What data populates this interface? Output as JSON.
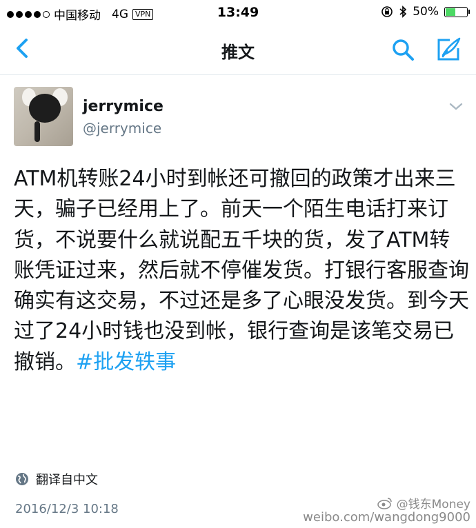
{
  "status_bar": {
    "carrier": "中国移动",
    "network": "4G",
    "vpn": "VPN",
    "time": "13:49",
    "battery": "50%",
    "battery_level": 0.5
  },
  "nav": {
    "title": "推文"
  },
  "tweet": {
    "display_name": "jerrymice",
    "handle": "@jerrymice",
    "text": "ATM机转账24小时到帐还可撤回的政策才出来三天，骗子已经用上了。前天一个陌生电话打来订货，不说要什么就说配五千块的货，发了ATM转账凭证过来，然后就不停催发货。打银行客服查询确实有这交易，不过还是多了心眼没发货。到今天过了24小时钱也没到帐，银行查询是该笔交易已撤销。",
    "hashtag": "#批发轶事",
    "translate_label": "翻译自中文",
    "timestamp": "2016/12/3 10:18"
  },
  "watermark": {
    "line1": "@钱东Money",
    "line2": "weibo.com/wangdong9000"
  },
  "colors": {
    "accent": "#1da1f2",
    "secondary_text": "#657786",
    "battery_green": "#4cd964"
  }
}
